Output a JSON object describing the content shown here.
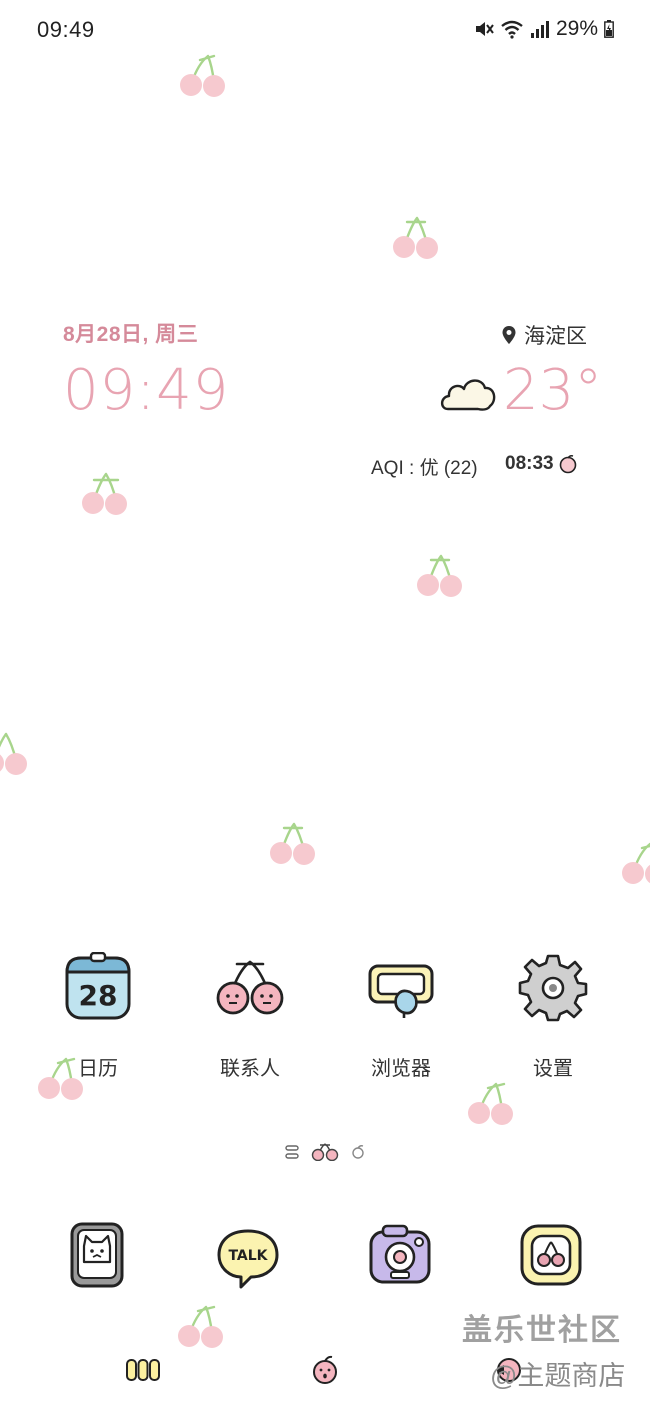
{
  "status_bar": {
    "time": "09:49",
    "battery": "29%"
  },
  "clock": {
    "date": "8月28日, 周三",
    "time": "09:49"
  },
  "weather": {
    "location": "海淀区",
    "temperature": "23°",
    "aqi": "AQI : 优 (22)",
    "sunrise": "08:33"
  },
  "apps": [
    {
      "label": "日历",
      "icon_text": "28"
    },
    {
      "label": "联系人"
    },
    {
      "label": "浏览器"
    },
    {
      "label": "设置"
    }
  ],
  "dock": {
    "talk_text": "TALK"
  },
  "watermark": {
    "line1": "盖乐世社区",
    "line2": "@主题商店"
  },
  "colors": {
    "accent_pink": "#e8a4b2",
    "cherry_pink": "#f6c9cf",
    "stem_green": "#a8d58c"
  }
}
